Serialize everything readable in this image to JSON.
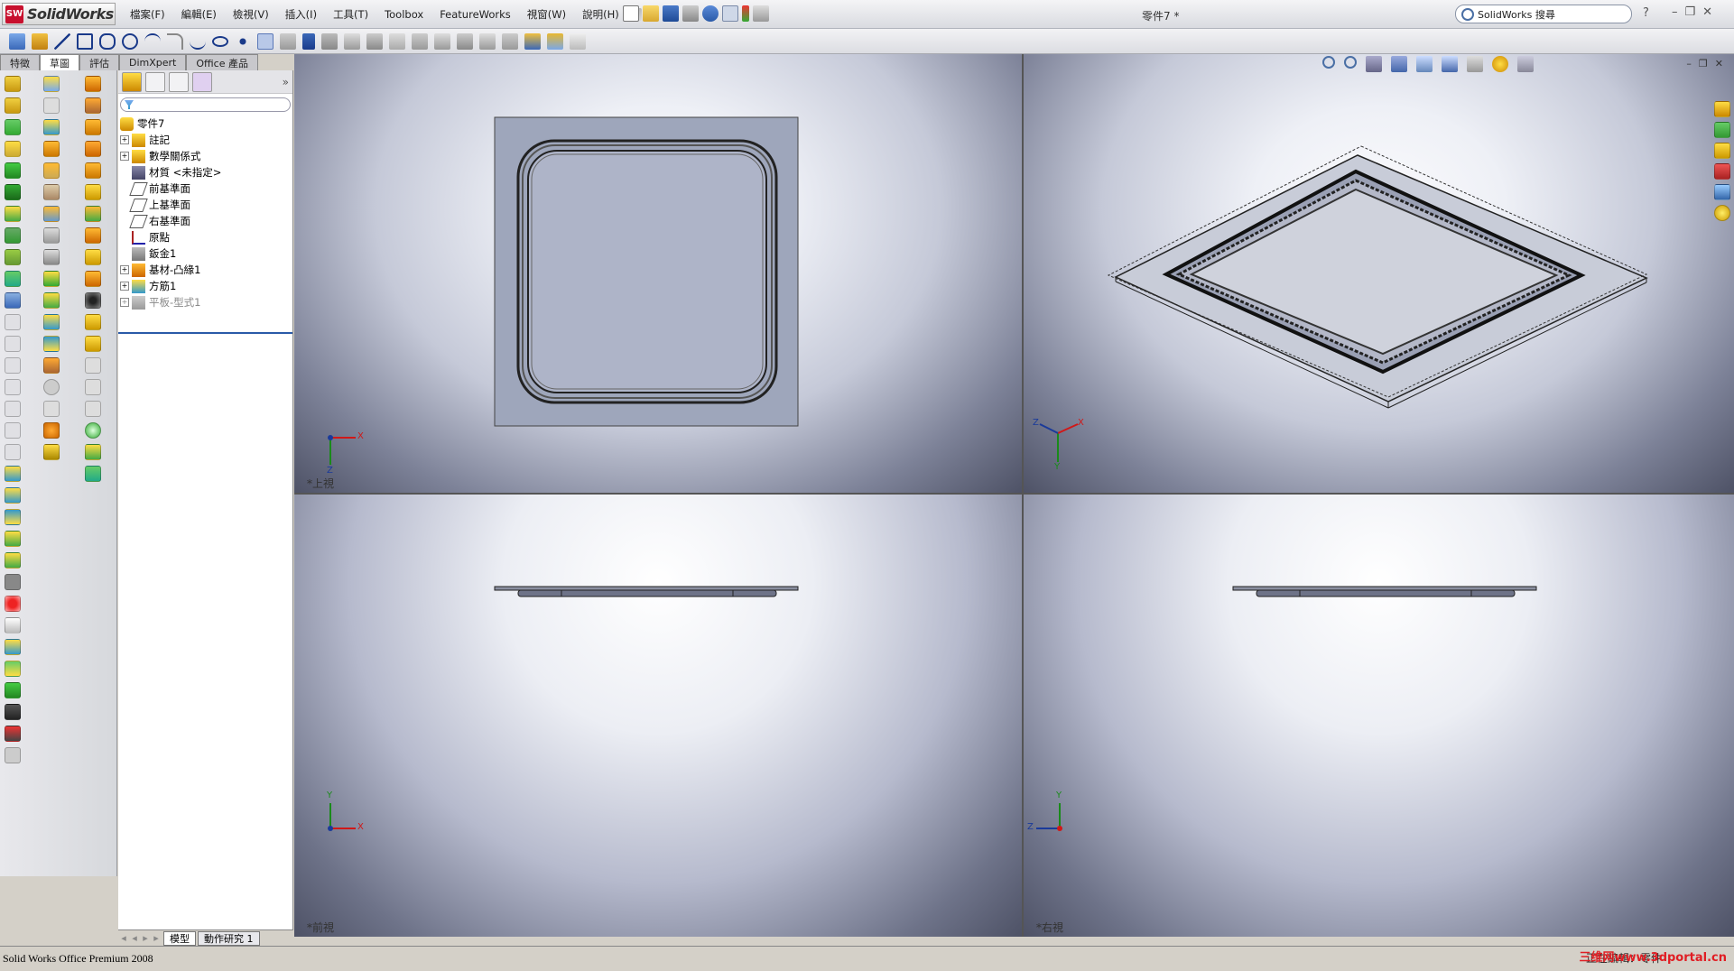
{
  "app": {
    "name": "SolidWorks",
    "logo_mark": "SW",
    "document_title": "零件7 *"
  },
  "menus": [
    "檔案(F)",
    "編輯(E)",
    "檢視(V)",
    "插入(I)",
    "工具(T)",
    "Toolbox",
    "FeatureWorks",
    "視窗(W)",
    "說明(H)"
  ],
  "search": {
    "placeholder": "SolidWorks 搜尋"
  },
  "window_controls": {
    "help": "?",
    "minimize": "–",
    "restore": "❐",
    "close": "✕"
  },
  "command_manager_tabs": [
    "特徵",
    "草圖",
    "評估",
    "DimXpert",
    "Office 產品"
  ],
  "feature_manager": {
    "root": "零件7",
    "items": [
      {
        "label": "註記",
        "expandable": true,
        "icon": "annotations-icon",
        "dim": false
      },
      {
        "label": "數學關係式",
        "expandable": true,
        "icon": "equations-icon",
        "dim": false
      },
      {
        "label": "材質 <未指定>",
        "expandable": false,
        "icon": "material-icon",
        "dim": false
      },
      {
        "label": "前基準面",
        "expandable": false,
        "icon": "plane-icon",
        "dim": false
      },
      {
        "label": "上基準面",
        "expandable": false,
        "icon": "plane-icon",
        "dim": false
      },
      {
        "label": "右基準面",
        "expandable": false,
        "icon": "plane-icon",
        "dim": false
      },
      {
        "label": "原點",
        "expandable": false,
        "icon": "origin-icon",
        "dim": false
      },
      {
        "label": "鈑金1",
        "expandable": false,
        "icon": "sheetmetal-icon",
        "dim": false
      },
      {
        "label": "基材-凸緣1",
        "expandable": true,
        "icon": "base-flange-icon",
        "dim": false
      },
      {
        "label": "方筋1",
        "expandable": true,
        "icon": "rib-icon",
        "dim": false
      },
      {
        "label": "平板-型式1",
        "expandable": true,
        "icon": "flat-pattern-icon",
        "dim": true
      }
    ]
  },
  "bottom_tabs": [
    "模型",
    "動作研究 1"
  ],
  "viewports": {
    "top": {
      "label": "*上視"
    },
    "iso": {
      "label": ""
    },
    "front": {
      "label": "*前視"
    },
    "right": {
      "label": "*右視"
    }
  },
  "axes": {
    "x": "X",
    "y": "Y",
    "z": "Z"
  },
  "status": {
    "product": "Solid Works Office Premium 2008",
    "mode": "正在編輯：零件",
    "watermark": "三维网www.3dportal.cn"
  }
}
